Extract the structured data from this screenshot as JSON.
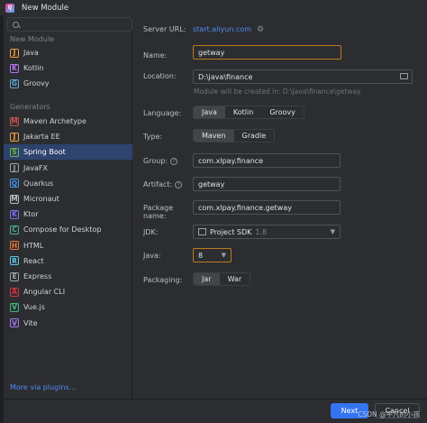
{
  "window": {
    "title": "New Module",
    "app_icon": "IJ"
  },
  "sidebar": {
    "search_placeholder": "",
    "section_new_module": "New Module",
    "new_module_items": [
      {
        "label": "Java",
        "icon": "java-icon",
        "color": "#f09a3e"
      },
      {
        "label": "Kotlin",
        "icon": "kotlin-icon",
        "color": "#b574f0"
      },
      {
        "label": "Groovy",
        "icon": "groovy-icon",
        "color": "#5ea8d6"
      }
    ],
    "section_generators": "Generators",
    "generator_items": [
      {
        "label": "Maven Archetype",
        "icon": "maven-icon",
        "color": "#c75450"
      },
      {
        "label": "Jakarta EE",
        "icon": "jakarta-icon",
        "color": "#f2a24a"
      },
      {
        "label": "Spring Boot",
        "icon": "spring-boot-icon",
        "color": "#6db33f",
        "selected": true
      },
      {
        "label": "JavaFX",
        "icon": "javafx-icon",
        "color": "#9da0a8"
      },
      {
        "label": "Quarkus",
        "icon": "quarkus-icon",
        "color": "#4695eb"
      },
      {
        "label": "Micronaut",
        "icon": "micronaut-icon",
        "color": "#bcbec4"
      },
      {
        "label": "Ktor",
        "icon": "ktor-icon",
        "color": "#7f6ff0"
      },
      {
        "label": "Compose for Desktop",
        "icon": "compose-icon",
        "color": "#4caf8e"
      },
      {
        "label": "HTML",
        "icon": "html-icon",
        "color": "#e8763a"
      },
      {
        "label": "React",
        "icon": "react-icon",
        "color": "#5fc8ea"
      },
      {
        "label": "Express",
        "icon": "express-icon",
        "color": "#9da0a8"
      },
      {
        "label": "Angular CLI",
        "icon": "angular-icon",
        "color": "#dd3340"
      },
      {
        "label": "Vue.js",
        "icon": "vue-icon",
        "color": "#42b883"
      },
      {
        "label": "Vite",
        "icon": "vite-icon",
        "color": "#a77cf7"
      }
    ],
    "more_plugins": "More via plugins..."
  },
  "form": {
    "server_url_label": "Server URL:",
    "server_url_value": "start.aliyun.com",
    "name_label": "Name:",
    "name_value": "getway",
    "location_label": "Location:",
    "location_value": "D:\\java\\finance",
    "location_hint": "Module will be created in: D:\\java\\finance\\getway",
    "language_label": "Language:",
    "language_options": [
      "Java",
      "Kotlin",
      "Groovy"
    ],
    "language_selected": "Java",
    "type_label": "Type:",
    "type_options": [
      "Maven",
      "Gradle"
    ],
    "type_selected": "Maven",
    "group_label": "Group:",
    "group_value": "com.xlpay.finance",
    "artifact_label": "Artifact:",
    "artifact_value": "getway",
    "package_label": "Package name:",
    "package_value": "com.xlpay.finance.getway",
    "jdk_label": "JDK:",
    "jdk_value": "Project SDK",
    "jdk_version": "1.8",
    "java_label": "Java:",
    "java_value": "8",
    "packaging_label": "Packaging:",
    "packaging_options": [
      "Jar",
      "War"
    ],
    "packaging_selected": "Jar"
  },
  "footer": {
    "next_label": "Next",
    "cancel_label": "Cancel"
  },
  "watermark": "CSDN @平凡的小孩",
  "colors": {
    "accent": "#3574f0",
    "selected_bg": "#2e436e",
    "focus": "#bd7a1e",
    "link": "#548af7"
  }
}
